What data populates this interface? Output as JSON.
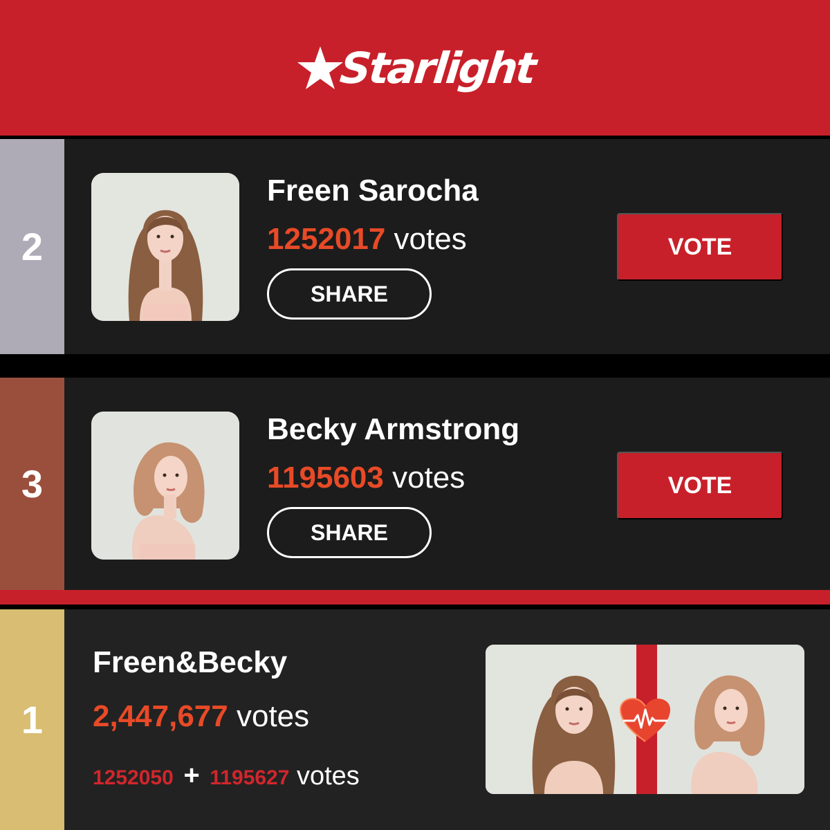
{
  "app": {
    "logo_text": "Starlight",
    "accent_color": "#c8202a",
    "vote_number_color": "#e84a27"
  },
  "ranking": [
    {
      "rank": "2",
      "name": "Freen Sarocha",
      "votes": "1252017",
      "votes_suffix": "votes",
      "share_label": "SHARE",
      "vote_label": "VOTE",
      "rank_color": "#aeaab6"
    },
    {
      "rank": "3",
      "name": "Becky Armstrong",
      "votes": "1195603",
      "votes_suffix": "votes",
      "share_label": "SHARE",
      "vote_label": "VOTE",
      "rank_color": "#9a4f3d"
    }
  ],
  "couple": {
    "rank": "1",
    "name": "Freen&Becky",
    "votes": "2,447,677",
    "votes_suffix": "votes",
    "part_a": "1252050",
    "plus": "+",
    "part_b": "1195627",
    "parts_suffix": "votes",
    "rank_color": "#d8bd72",
    "icon": "heart-pulse-icon"
  }
}
